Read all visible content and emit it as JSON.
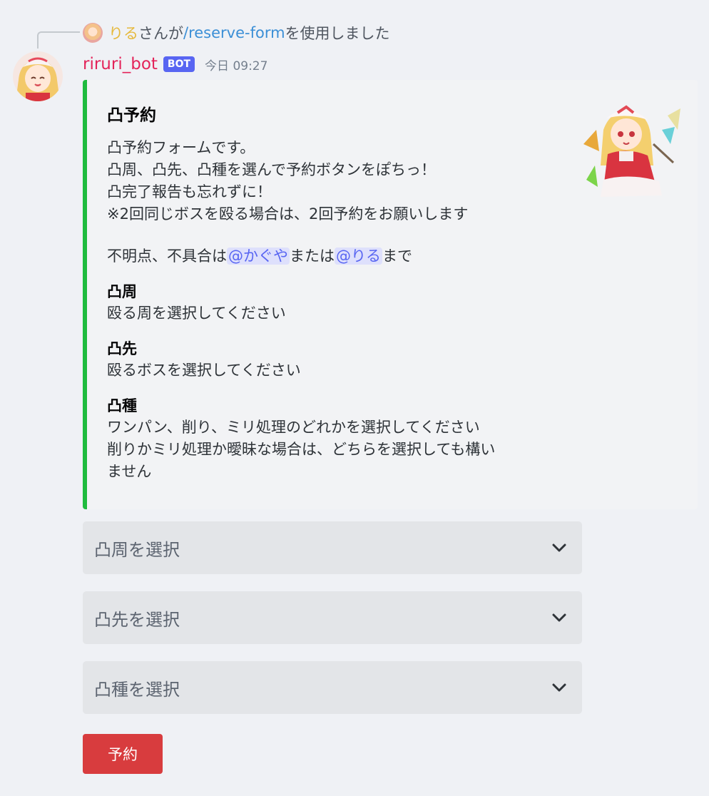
{
  "reply": {
    "user": "りる",
    "suffix_before": "さんが",
    "command": "/reserve-form",
    "suffix_after": "を使用しました"
  },
  "message": {
    "username": "riruri_bot",
    "badge": "BOT",
    "timestamp": "今日 09:27"
  },
  "embed": {
    "accent_color": "#1fbb3e",
    "title": "凸予約",
    "description_lines": [
      "凸予約フォームです。",
      "凸周、凸先、凸種を選んで予約ボタンをぽちっ！",
      "凸完了報告も忘れずに！",
      "※2回同じボスを殴る場合は、2回予約をお願いします"
    ],
    "contact": {
      "prefix": "不明点、不具合は",
      "mention1": "@かぐや",
      "middle": "または",
      "mention2": "@りる",
      "suffix": "まで"
    },
    "fields": [
      {
        "name": "凸周",
        "value_lines": [
          "殴る周を選択してください"
        ]
      },
      {
        "name": "凸先",
        "value_lines": [
          "殴るボスを選択してください"
        ]
      },
      {
        "name": "凸種",
        "value_lines": [
          "ワンパン、削り、ミリ処理のどれかを選択してください",
          "削りかミリ処理か曖昧な場合は、どちらを選択しても構い",
          "ません"
        ]
      }
    ]
  },
  "selects": [
    {
      "placeholder": "凸周を選択",
      "icon": "chevron-down-icon"
    },
    {
      "placeholder": "凸先を選択",
      "icon": "chevron-down-icon"
    },
    {
      "placeholder": "凸種を選択",
      "icon": "chevron-down-icon"
    }
  ],
  "button": {
    "label": "予約",
    "color": "#d83c3e"
  }
}
